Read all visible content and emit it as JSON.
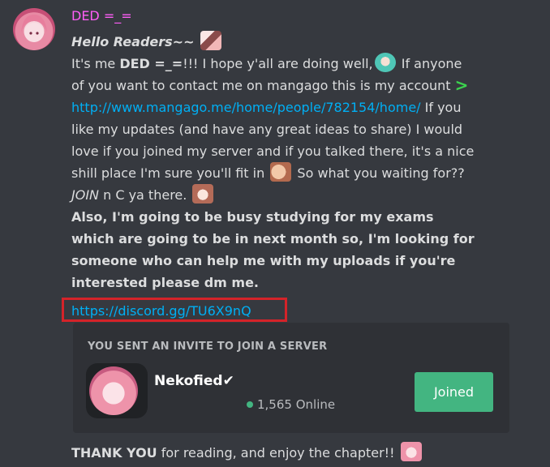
{
  "author": {
    "name": "DED =_=",
    "name_color": "#ff5ef7"
  },
  "message": {
    "greeting": "Hello Readers~~",
    "p1_a": "It's me ",
    "p1_b": "DED =_=",
    "p1_c": "!!! I hope y'all are doing well,",
    "p1_d": " If anyone of you want to contact me on mangago this is my account ",
    "profile_link": "http://www.mangago.me/home/people/782154/home/",
    "p1_e": " If you like my updates (and have any great ideas to share) I would love if you  joined my server and if you talked there, it's a nice shill place I'm sure you'll fit in ",
    "p1_f": " So what you waiting for?? ",
    "join_word": "JOIN",
    "p1_g": "  n C ya there.",
    "p2": "  Also, I'm going to be busy studying for my exams which are going to be in next month so, I'm looking for someone who can help me with my uploads if you're interested please dm me.",
    "invite_link": "https://discord.gg/TU6X9nQ",
    "thanks_bold": "THANK YOU",
    "thanks_rest": "  for reading, and enjoy the chapter!!"
  },
  "invite": {
    "heading": "YOU SENT AN INVITE TO JOIN A SERVER",
    "server_name": "Nekofied✔",
    "online": "1,565 Online",
    "button": "Joined",
    "button_color": "#43b581"
  },
  "icons": {
    "arrow": "green-right-arrow-icon",
    "emojis": [
      "fox-emoji",
      "teal-hair-emoji",
      "hand-emoji",
      "girl-emoji",
      "pink-hair-emoji"
    ]
  }
}
